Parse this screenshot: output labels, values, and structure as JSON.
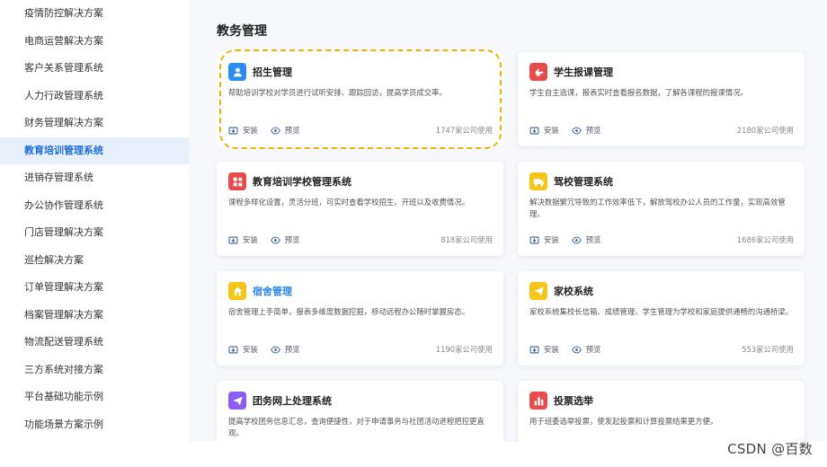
{
  "sidebar": {
    "items": [
      {
        "label": "疫情防控解决方案"
      },
      {
        "label": "电商运营解决方案"
      },
      {
        "label": "客户关系管理系统"
      },
      {
        "label": "人力行政管理系统"
      },
      {
        "label": "财务管理解决方案"
      },
      {
        "label": "教育培训管理系统",
        "active": true
      },
      {
        "label": "进销存管理系统"
      },
      {
        "label": "办公协作管理系统"
      },
      {
        "label": "门店管理解决方案"
      },
      {
        "label": "巡检解决方案"
      },
      {
        "label": "订单管理解决方案"
      },
      {
        "label": "档案管理解决方案"
      },
      {
        "label": "物流配送管理系统"
      },
      {
        "label": "三方系统对接方案"
      },
      {
        "label": "平台基础功能示例"
      },
      {
        "label": "功能场景方案示例"
      }
    ]
  },
  "main": {
    "section_title": "教务管理",
    "install_label": "安装",
    "preview_label": "预览",
    "cards": [
      {
        "title": "招生管理",
        "desc": "帮助培训学校对学员进行试听安排、跟踪回访，提高学员成交率。",
        "usage": "1747家公司使用",
        "icon": "user-icon",
        "color": "#2d8cf0"
      },
      {
        "title": "学生报课管理",
        "desc": "学生自主选课，报表实时查看报名数据，了解各课程的报课情况。",
        "usage": "2180家公司使用",
        "icon": "hand-icon",
        "color": "#e84b4b"
      },
      {
        "title": "教育培训学校管理系统",
        "desc": "课程多样化设置，灵活分班，可实时查看学校招生、开班以及收费情况。",
        "usage": "818家公司使用",
        "icon": "apps-icon",
        "color": "#e84b4b"
      },
      {
        "title": "驾校管理系统",
        "desc": "解决数据繁冗导致的工作效率低下，解放驾校办公人员的工作量，实现高效管理。",
        "usage": "1686家公司使用",
        "icon": "truck-icon",
        "color": "#f5c518"
      },
      {
        "title": "宿舍管理",
        "desc": "宿舍管理上手简单，报表多维度数据挖掘，移动远程办公随时掌握房态。",
        "usage": "1190家公司使用",
        "icon": "home-icon",
        "color": "#f5c518"
      },
      {
        "title": "家校系统",
        "desc": "家校系统集校长信箱、成绩管理、学生管理为学校和家庭提供通畅的沟通桥梁。",
        "usage": "553家公司使用",
        "icon": "send-icon",
        "color": "#f5c518"
      },
      {
        "title": "团务网上处理系统",
        "desc": "提高学校团务信息汇总，查询便捷性，对于申请事务与社团活动进程把控更直观。",
        "usage": "",
        "icon": "send-icon",
        "color": "#8a5cf0"
      },
      {
        "title": "投票选举",
        "desc": "用于班委选举投票，使发起投票和计算投票结果更方便。",
        "usage": "",
        "icon": "bar-chart-icon",
        "color": "#e84b4b"
      }
    ]
  },
  "watermark": "CSDN @百数"
}
